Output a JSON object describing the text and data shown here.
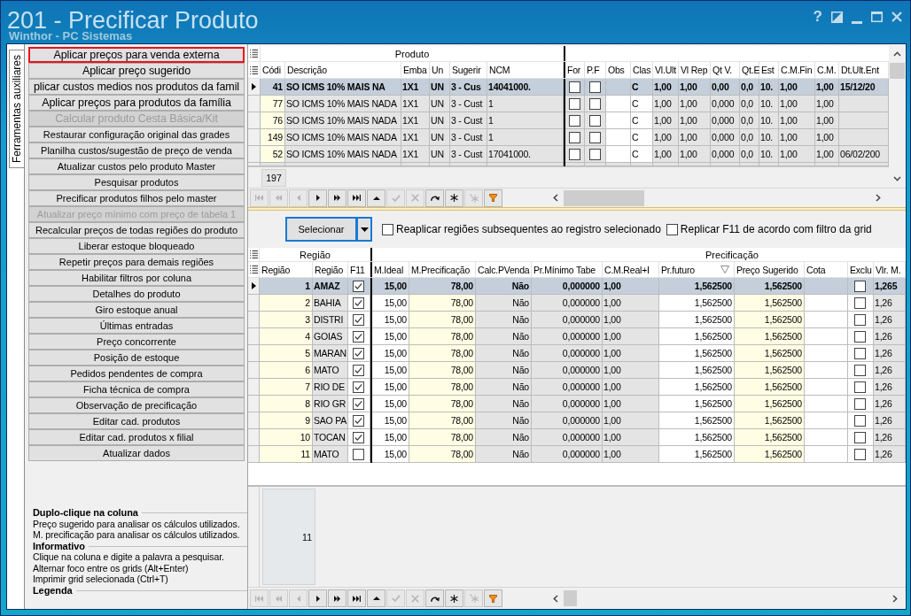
{
  "window": {
    "title": "201 - Precificar Produto",
    "subtitle": "Winthor - PC Sistemas",
    "help_button": "?"
  },
  "side_tabs": [
    {
      "label": "Ferramentas auxiliares",
      "selected": true
    }
  ],
  "actions": [
    {
      "label": "Aplicar preços para venda externa",
      "kind": "large",
      "disabled": false,
      "highlighted": true
    },
    {
      "label": "Aplicar preço sugerido",
      "kind": "large",
      "disabled": false,
      "highlighted": false
    },
    {
      "label": "plicar custos medios nos produtos da famil",
      "kind": "large",
      "disabled": false,
      "highlighted": false
    },
    {
      "label": "Aplicar preços para produtos da família",
      "kind": "large",
      "disabled": false,
      "highlighted": false
    },
    {
      "label": "Calcular produto Cesta Básica/Kit",
      "kind": "large",
      "disabled": true,
      "highlighted": false
    },
    {
      "label": "Restaurar configuração original das grades",
      "kind": "small",
      "disabled": false,
      "highlighted": false
    },
    {
      "label": "Planilha custos/sugestão de preço de venda",
      "kind": "small",
      "disabled": false,
      "highlighted": false
    },
    {
      "label": "Atualizar custos pelo produto Master",
      "kind": "small",
      "disabled": false,
      "highlighted": false
    },
    {
      "label": "Pesquisar produtos",
      "kind": "small",
      "disabled": false,
      "highlighted": false
    },
    {
      "label": "Precificar produtos filhos pelo master",
      "kind": "small",
      "disabled": false,
      "highlighted": false
    },
    {
      "label": "Atualizar preço mínimo com preço de tabela 1",
      "kind": "small",
      "disabled": true,
      "highlighted": false
    },
    {
      "label": "Recalcular preços de todas regiões do produto",
      "kind": "small",
      "disabled": false,
      "highlighted": false
    },
    {
      "label": "Liberar estoque bloqueado",
      "kind": "small",
      "disabled": false,
      "highlighted": false
    },
    {
      "label": "Repetir preços para demais regiões",
      "kind": "small",
      "disabled": false,
      "highlighted": false
    },
    {
      "label": "Habilitar filtros por coluna",
      "kind": "small",
      "disabled": false,
      "highlighted": false
    },
    {
      "label": "Detalhes do produto",
      "kind": "small",
      "disabled": false,
      "highlighted": false
    },
    {
      "label": "Giro estoque anual",
      "kind": "small",
      "disabled": false,
      "highlighted": false
    },
    {
      "label": "Últimas entradas",
      "kind": "small",
      "disabled": false,
      "highlighted": false
    },
    {
      "label": "Preço concorrente",
      "kind": "small",
      "disabled": false,
      "highlighted": false
    },
    {
      "label": "Posição de estoque",
      "kind": "small",
      "disabled": false,
      "highlighted": false
    },
    {
      "label": "Pedidos pendentes de compra",
      "kind": "small",
      "disabled": false,
      "highlighted": false
    },
    {
      "label": "Ficha técnica de compra",
      "kind": "small",
      "disabled": false,
      "highlighted": false
    },
    {
      "label": "Observação de precificação",
      "kind": "small",
      "disabled": false,
      "highlighted": false
    },
    {
      "label": "Editar cad. produtos",
      "kind": "small",
      "disabled": false,
      "highlighted": false
    },
    {
      "label": "Editar cad. produtos x filial",
      "kind": "small",
      "disabled": false,
      "highlighted": false
    },
    {
      "label": "Atualizar dados",
      "kind": "small",
      "disabled": false,
      "highlighted": false
    }
  ],
  "legend": [
    {
      "heading": "Duplo-clique na coluna",
      "lines": [
        "Preço sugerido para analisar os cálculos utilizados.",
        "M. precificação para analisar os cálculos utilizados."
      ]
    },
    {
      "heading": "Informativo",
      "lines": [
        "Clique na coluna e digite a palavra a pesquisar.",
        "Alternar foco entre os grids (Alt+Enter)",
        "Imprimir grid selecionada (Ctrl+T)"
      ]
    },
    {
      "heading": "Legenda"
    }
  ],
  "product_grid": {
    "column_groups": [
      {
        "label": "Produto",
        "columns": [
          {
            "label": "Códi",
            "kind": "text"
          },
          {
            "label": "Descrição",
            "kind": "text"
          },
          {
            "label": "Emba",
            "kind": "text"
          },
          {
            "label": "Un",
            "kind": "text"
          },
          {
            "label": "Sugerir",
            "kind": "text"
          },
          {
            "label": "NCM",
            "kind": "text"
          }
        ]
      },
      {
        "columns": [
          {
            "label": "For",
            "kind": "check"
          },
          {
            "label": "P.F",
            "kind": "check"
          },
          {
            "label": "Obs",
            "kind": "text"
          },
          {
            "label": "Clas",
            "kind": "text"
          },
          {
            "label": "Vl.Ult",
            "kind": "text"
          },
          {
            "label": "Vl Rep",
            "kind": "text"
          },
          {
            "label": "Qt V.",
            "kind": "text"
          },
          {
            "label": "Qt.E",
            "kind": "text"
          },
          {
            "label": "Est",
            "kind": "text"
          },
          {
            "label": "C.M.Fin",
            "kind": "text"
          },
          {
            "label": "C.M.",
            "kind": "text"
          },
          {
            "label": "Dt.Ult.Ent",
            "kind": "text"
          }
        ]
      }
    ],
    "rows": [
      {
        "selected": true,
        "cells": [
          "41",
          "SO ICMS 10% MAIS NA",
          "1X1",
          "UN",
          "3 - Cus",
          "14041000.",
          {
            "checked": false
          },
          {
            "checked": false
          },
          null,
          "C",
          "1,00",
          "1,00",
          "0,00",
          "0,0",
          "10.",
          "1,00",
          "1,00",
          "15/12/20"
        ]
      },
      {
        "selected": false,
        "cells": [
          "77",
          "SO ICMS 10% MAIS NADA",
          "1X1",
          "UN",
          "3 - Cust",
          "1",
          {
            "checked": false
          },
          {
            "checked": false
          },
          null,
          "C",
          "1,00",
          "1,00",
          "0,000",
          "0,0",
          "10.",
          "1,00",
          "1,00",
          null
        ]
      },
      {
        "selected": false,
        "cells": [
          "76",
          "SO ICMS 10% MAIS NADA",
          "1X1",
          "UN",
          "3 - Cust",
          "1",
          {
            "checked": false
          },
          {
            "checked": false
          },
          null,
          "C",
          "1,00",
          "1,00",
          "0,000",
          "0,0",
          "10.",
          "1,00",
          "1,00",
          null
        ]
      },
      {
        "selected": false,
        "cells": [
          "149",
          "SO ICMS 10% MAIS NADA",
          "1X1",
          "UN",
          "3 - Cust",
          "1",
          {
            "checked": false
          },
          {
            "checked": false
          },
          null,
          "C",
          "1,00",
          "1,00",
          "0,000",
          "0,0",
          "10.",
          "1,00",
          "1,00",
          null
        ]
      },
      {
        "selected": false,
        "cells": [
          "52",
          "SO ICMS 10% MAIS NADA",
          "1X1",
          "UN",
          "3 - Cust",
          "17041000.",
          {
            "checked": false
          },
          {
            "checked": false
          },
          null,
          "C",
          "1,00",
          "1,00",
          "0,000",
          "0,0",
          "10.",
          "1,00",
          "1,00",
          "06/02/200"
        ]
      }
    ],
    "footer": "197"
  },
  "product_navigator": [
    {
      "kind": "first",
      "disabled": true
    },
    {
      "kind": "pageback",
      "disabled": true
    },
    {
      "kind": "back",
      "disabled": true
    },
    {
      "kind": "next",
      "disabled": false
    },
    {
      "kind": "pagenext",
      "disabled": false
    },
    {
      "kind": "last",
      "disabled": false
    },
    {
      "kind": "up",
      "disabled": false
    },
    {
      "kind": "post",
      "disabled": true
    },
    {
      "kind": "cancel",
      "disabled": true
    },
    {
      "kind": "refresh",
      "disabled": false
    },
    {
      "kind": "asterisk",
      "disabled": false
    },
    {
      "kind": "burst",
      "disabled": true
    },
    {
      "kind": "filter",
      "disabled": false
    }
  ],
  "selection_bar": {
    "button": "Selecionar",
    "options": [
      {
        "label": "Reaplicar regiões subsequentes ao registro selecionado",
        "checked": false
      },
      {
        "label": "Replicar F11 de acordo com filtro da grid",
        "checked": false
      }
    ]
  },
  "region_grid": {
    "column_groups": [
      {
        "label": "Região",
        "columns": [
          {
            "label": "Região",
            "kind": "text",
            "filter": false
          },
          {
            "label": "Região",
            "kind": "text",
            "filter": false
          },
          {
            "label": "F11",
            "kind": "check",
            "filter": false
          }
        ]
      },
      {
        "label": "Precificação",
        "columns": [
          {
            "label": "M.Ideal",
            "kind": "text",
            "filter": false
          },
          {
            "label": "M.Precificação",
            "kind": "text",
            "filter": false
          },
          {
            "label": "Calc.PVenda",
            "kind": "text",
            "filter": false
          },
          {
            "label": "Pr.Mínimo Tabe",
            "kind": "text",
            "filter": false
          },
          {
            "label": "C.M.Real+I",
            "kind": "text",
            "filter": false
          },
          {
            "label": "Pr.futuro",
            "kind": "text",
            "filter": true
          },
          {
            "label": "Preço Sugerido",
            "kind": "text",
            "filter": false
          },
          {
            "label": "Cota",
            "kind": "text",
            "filter": false
          },
          {
            "label": "Exclu",
            "kind": "check",
            "filter": false
          },
          {
            "label": "Vlr. M.",
            "kind": "text",
            "filter": false
          }
        ]
      }
    ],
    "rows": [
      {
        "selected": true,
        "cells": [
          "1",
          "AMAZ",
          {
            "checked": true
          },
          "15,00",
          "78,00",
          "Não",
          "0,000000",
          "1,00",
          "1,562500",
          "1,562500",
          null,
          {
            "checked": false
          },
          "1,265"
        ]
      },
      {
        "selected": false,
        "cells": [
          "2",
          "BAHIA",
          {
            "checked": true
          },
          "15,00",
          "78,00",
          "Não",
          "0,000000",
          "1,00",
          "1,562500",
          "1,562500",
          null,
          {
            "checked": false
          },
          "1,26"
        ]
      },
      {
        "selected": false,
        "cells": [
          "3",
          "DISTRI",
          {
            "checked": true
          },
          "15,00",
          "78,00",
          "Não",
          "0,000000",
          "1,00",
          "1,562500",
          "1,562500",
          null,
          {
            "checked": false
          },
          "1,26"
        ]
      },
      {
        "selected": false,
        "cells": [
          "4",
          "GOIAS",
          {
            "checked": true
          },
          "15,00",
          "78,00",
          "Não",
          "0,000000",
          "1,00",
          "1,562500",
          "1,562500",
          null,
          {
            "checked": false
          },
          "1,26"
        ]
      },
      {
        "selected": false,
        "cells": [
          "5",
          "MARAN",
          {
            "checked": true
          },
          "15,00",
          "78,00",
          "Não",
          "0,000000",
          "1,00",
          "1,562500",
          "1,562500",
          null,
          {
            "checked": false
          },
          "1,26"
        ]
      },
      {
        "selected": false,
        "cells": [
          "6",
          "MATO",
          {
            "checked": true
          },
          "15,00",
          "78,00",
          "Não",
          "0,000000",
          "1,00",
          "1,562500",
          "1,562500",
          null,
          {
            "checked": false
          },
          "1,26"
        ]
      },
      {
        "selected": false,
        "cells": [
          "7",
          "RIO DE",
          {
            "checked": true
          },
          "15,00",
          "78,00",
          "Não",
          "0,000000",
          "1,00",
          "1,562500",
          "1,562500",
          null,
          {
            "checked": false
          },
          "1,26"
        ]
      },
      {
        "selected": false,
        "cells": [
          "8",
          "RIO GR",
          {
            "checked": true
          },
          "15,00",
          "78,00",
          "Não",
          "0,000000",
          "1,00",
          "1,562500",
          "1,562500",
          null,
          {
            "checked": false
          },
          "1,26"
        ]
      },
      {
        "selected": false,
        "cells": [
          "9",
          "SAO PA",
          {
            "checked": true
          },
          "15,00",
          "78,00",
          "Não",
          "0,000000",
          "1,00",
          "1,562500",
          "1,562500",
          null,
          {
            "checked": false
          },
          "1,26"
        ]
      },
      {
        "selected": false,
        "cells": [
          "10",
          "TOCAN",
          {
            "checked": true
          },
          "15,00",
          "78,00",
          "Não",
          "0,000000",
          "1,00",
          "1,562500",
          "1,562500",
          null,
          {
            "checked": false
          },
          "1,26"
        ]
      },
      {
        "selected": false,
        "cells": [
          "11",
          "MATO",
          {
            "checked": false
          },
          "15,00",
          "78,00",
          "Não",
          "0,000000",
          "1,00",
          "1,562500",
          "1,562500",
          null,
          {
            "checked": false
          },
          "1,26"
        ]
      }
    ],
    "footer": "11"
  },
  "region_navigator": [
    {
      "kind": "first",
      "disabled": true
    },
    {
      "kind": "pageback",
      "disabled": true
    },
    {
      "kind": "back",
      "disabled": true
    },
    {
      "kind": "next",
      "disabled": false
    },
    {
      "kind": "pagenext",
      "disabled": false
    },
    {
      "kind": "last",
      "disabled": false
    },
    {
      "kind": "up",
      "disabled": false
    },
    {
      "kind": "post",
      "disabled": true
    },
    {
      "kind": "cancel",
      "disabled": true
    },
    {
      "kind": "refresh",
      "disabled": false
    },
    {
      "kind": "asterisk",
      "disabled": false
    },
    {
      "kind": "burst",
      "disabled": true
    },
    {
      "kind": "filter",
      "disabled": false
    }
  ]
}
